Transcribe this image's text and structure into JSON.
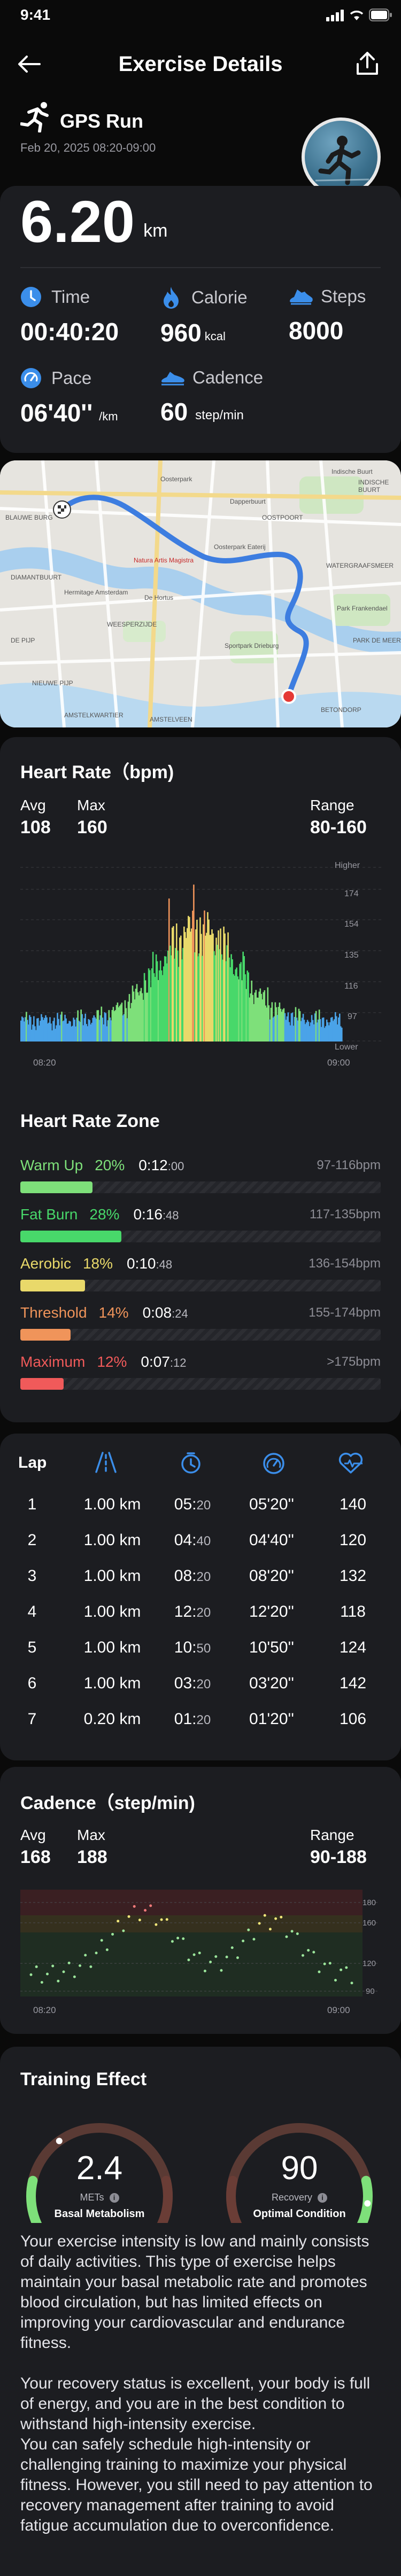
{
  "status_bar": {
    "time": "9:41"
  },
  "header": {
    "title": "Exercise Details"
  },
  "activity": {
    "name": "GPS Run",
    "date": "Feb 20, 2025 08:20-09:00"
  },
  "summary": {
    "distance": "6.20",
    "distance_unit": "km",
    "stats": [
      {
        "label": "Time",
        "value": "00:40:20",
        "unit": "",
        "icon": "clock-icon",
        "color": "#3b8eea"
      },
      {
        "label": "Calorie",
        "value": "960",
        "unit": "kcal",
        "icon": "flame-icon",
        "color": "#3b8eea"
      },
      {
        "label": "Steps",
        "value": "8000",
        "unit": "",
        "icon": "shoe-icon",
        "color": "#3b8eea"
      },
      {
        "label": "Pace",
        "value": "06'40''",
        "unit": "/km",
        "icon": "speedometer-icon",
        "color": "#3b8eea"
      },
      {
        "label": "Cadence",
        "value": "60",
        "unit": "step/min",
        "icon": "running-shoe-icon",
        "color": "#3b8eea"
      }
    ]
  },
  "map": {
    "labels": [
      "Oosterpark",
      "Dapperbuurt",
      "OOSTPOORT",
      "Indische Buurt",
      "INDISCHE BUURT",
      "BLAUWE BURG",
      "DIAMANTBUURT",
      "Natura Artis Magistra",
      "Hermitage Amsterdam",
      "De Hortus",
      "WEESPERZIJDE",
      "DE PIJP",
      "Sportpark Drieburg",
      "Park Frankendael",
      "AMSTELVEEN",
      "NIEUWE PIJP",
      "Oosterpark Eaterij",
      "BETONDORP",
      "WATERGRAAFSMEER",
      "AMSTELKWARTIER",
      "PARK DE MEER"
    ]
  },
  "heart_rate": {
    "title": "Heart Rate（bpm)",
    "avg_label": "Avg",
    "avg": "108",
    "max_label": "Max",
    "max": "160",
    "range_label": "Range",
    "range": "80-160",
    "axis_top": "Higher",
    "axis_bottom": "Lower",
    "y_ticks": [
      "174",
      "154",
      "135",
      "116",
      "97"
    ],
    "x_start": "08:20",
    "x_end": "09:00"
  },
  "hr_zone": {
    "title": "Heart Rate Zone",
    "zones": [
      {
        "name": "Warm Up",
        "pct": "20%",
        "time_main": "0:12",
        "time_sec": ":00",
        "range": "97-116bpm",
        "color": "#7ee07a",
        "fill": 0.2
      },
      {
        "name": "Fat Burn",
        "pct": "28%",
        "time_main": "0:16",
        "time_sec": ":48",
        "range": "117-135bpm",
        "color": "#48d86a",
        "fill": 0.28
      },
      {
        "name": "Aerobic",
        "pct": "18%",
        "time_main": "0:10",
        "time_sec": ":48",
        "range": "136-154bpm",
        "color": "#e9d96a",
        "fill": 0.18
      },
      {
        "name": "Threshold",
        "pct": "14%",
        "time_main": "0:08",
        "time_sec": ":24",
        "range": "155-174bpm",
        "color": "#f0945a",
        "fill": 0.14
      },
      {
        "name": "Maximum",
        "pct": "12%",
        "time_main": "0:07",
        "time_sec": ":12",
        "range": ">175bpm",
        "color": "#f05a5a",
        "fill": 0.12
      }
    ]
  },
  "laps": {
    "header": "Lap",
    "rows": [
      {
        "lap": "1",
        "dist": "1.00 km",
        "time_main": "05:",
        "time_sec": "20",
        "pace": "05'20''",
        "hr": "140"
      },
      {
        "lap": "2",
        "dist": "1.00 km",
        "time_main": "04:",
        "time_sec": "40",
        "pace": "04'40''",
        "hr": "120"
      },
      {
        "lap": "3",
        "dist": "1.00 km",
        "time_main": "08:",
        "time_sec": "20",
        "pace": "08'20''",
        "hr": "132"
      },
      {
        "lap": "4",
        "dist": "1.00 km",
        "time_main": "12:",
        "time_sec": "20",
        "pace": "12'20''",
        "hr": "118"
      },
      {
        "lap": "5",
        "dist": "1.00 km",
        "time_main": "10:",
        "time_sec": "50",
        "pace": "10'50''",
        "hr": "124"
      },
      {
        "lap": "6",
        "dist": "1.00 km",
        "time_main": "03:",
        "time_sec": "20",
        "pace": "03'20''",
        "hr": "142"
      },
      {
        "lap": "7",
        "dist": "0.20 km",
        "time_main": "01:",
        "time_sec": "20",
        "pace": "01'20''",
        "hr": "106"
      }
    ]
  },
  "cadence": {
    "title": "Cadence（step/min)",
    "avg_label": "Avg",
    "avg": "168",
    "max_label": "Max",
    "max": "188",
    "range_label": "Range",
    "range": "90-188",
    "y_ticks": [
      "180",
      "160",
      "120",
      "90"
    ],
    "x_start": "08:20",
    "x_end": "09:00"
  },
  "training": {
    "title": "Training Effect",
    "mets_value": "2.4",
    "mets_label": "METs",
    "mets_caption": "Basal Metabolism",
    "mets_fill": 0.35,
    "recovery_value": "90",
    "recovery_label": "Recovery",
    "recovery_caption": "Optimal Condition",
    "recovery_fill": 0.9,
    "para1": "Your exercise intensity is low and mainly consists of daily activities. This type of exercise helps maintain your basal metabolic rate and promotes blood circulation, but has limited effects on improving your cardiovascular and endurance fitness.",
    "para2": "Your recovery status is excellent, your body is full of energy, and you are in the best condition to withstand high-intensity exercise.",
    "para3": " You can safely schedule high-intensity or challenging training to maximize your physical fitness. However, you still need to pay attention to recovery management after training to avoid fatigue accumulation due to overconfidence."
  }
}
